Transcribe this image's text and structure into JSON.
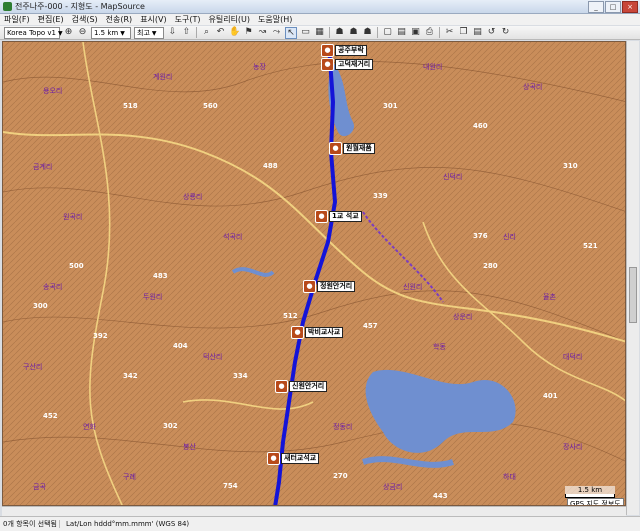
{
  "window": {
    "title": "전주나주-000 - 지형도 - MapSource",
    "controls": [
      "_",
      "□",
      "×"
    ]
  },
  "menu": [
    "파일(F)",
    "편집(E)",
    "검색(S)",
    "전송(R)",
    "표시(V)",
    "도구(T)",
    "유틸리티(U)",
    "도움말(H)"
  ],
  "toolbar": {
    "map_product": "Korea Topo v1",
    "zoom_level": "1.5 km",
    "detail": "최고"
  },
  "waypoints": [
    "공주부락",
    "고덕재거리",
    "원월재품",
    "1교 석교",
    "정원안거리",
    "박비교사교",
    "신원안거리",
    "새터교석교"
  ],
  "map_labels": [
    {
      "text": "용오리",
      "kind": "v"
    },
    {
      "text": "계원리",
      "kind": "v"
    },
    {
      "text": "농장",
      "kind": "v"
    },
    {
      "text": "내원리",
      "kind": "v"
    },
    {
      "text": "상곡리",
      "kind": "v"
    },
    {
      "text": "신덕리",
      "kind": "v"
    },
    {
      "text": "금계리",
      "kind": "v"
    },
    {
      "text": "원곡리",
      "kind": "v"
    },
    {
      "text": "상룡리",
      "kind": "v"
    },
    {
      "text": "석곡리",
      "kind": "v"
    },
    {
      "text": "신리",
      "kind": "v"
    },
    {
      "text": "송곡리",
      "kind": "v"
    },
    {
      "text": "두원리",
      "kind": "v"
    },
    {
      "text": "신원리",
      "kind": "v"
    },
    {
      "text": "율촌",
      "kind": "v"
    },
    {
      "text": "구산리",
      "kind": "v"
    },
    {
      "text": "덕산리",
      "kind": "v"
    },
    {
      "text": "학동",
      "kind": "v"
    },
    {
      "text": "대덕리",
      "kind": "v"
    },
    {
      "text": "연화",
      "kind": "v"
    },
    {
      "text": "봉산",
      "kind": "v"
    },
    {
      "text": "상운리",
      "kind": "v"
    },
    {
      "text": "정동리",
      "kind": "v"
    },
    {
      "text": "장사리",
      "kind": "v"
    },
    {
      "text": "구례",
      "kind": "v"
    },
    {
      "text": "상금리",
      "kind": "v"
    },
    {
      "text": "하대",
      "kind": "v"
    },
    {
      "text": "금곡",
      "kind": "v"
    },
    {
      "text": "518",
      "kind": "d"
    },
    {
      "text": "300",
      "kind": "d"
    },
    {
      "text": "392",
      "kind": "d"
    },
    {
      "text": "483",
      "kind": "d"
    },
    {
      "text": "404",
      "kind": "d"
    },
    {
      "text": "560",
      "kind": "d"
    },
    {
      "text": "488",
      "kind": "d"
    },
    {
      "text": "301",
      "kind": "d"
    },
    {
      "text": "460",
      "kind": "d"
    },
    {
      "text": "310",
      "kind": "d"
    },
    {
      "text": "500",
      "kind": "d"
    },
    {
      "text": "339",
      "kind": "d"
    },
    {
      "text": "280",
      "kind": "d"
    },
    {
      "text": "521",
      "kind": "d"
    },
    {
      "text": "457",
      "kind": "d"
    },
    {
      "text": "334",
      "kind": "d"
    },
    {
      "text": "342",
      "kind": "d"
    },
    {
      "text": "376",
      "kind": "d"
    },
    {
      "text": "512",
      "kind": "d"
    },
    {
      "text": "452",
      "kind": "d"
    },
    {
      "text": "754",
      "kind": "d"
    },
    {
      "text": "401",
      "kind": "d"
    },
    {
      "text": "443",
      "kind": "d"
    },
    {
      "text": "302",
      "kind": "d"
    },
    {
      "text": "270",
      "kind": "d"
    }
  ],
  "scale": "1.5 km",
  "gps_note": "GPS 지도 정보도",
  "status": {
    "selection": "0개 항목이 선택됨",
    "coords": "Lat/Lon hddd°mm.mmm' (WGS 84)"
  },
  "colors": {
    "terrain": "#c98d5a",
    "route": "#1414d8",
    "water": "#6f8fd0",
    "road": "#f0d080"
  }
}
